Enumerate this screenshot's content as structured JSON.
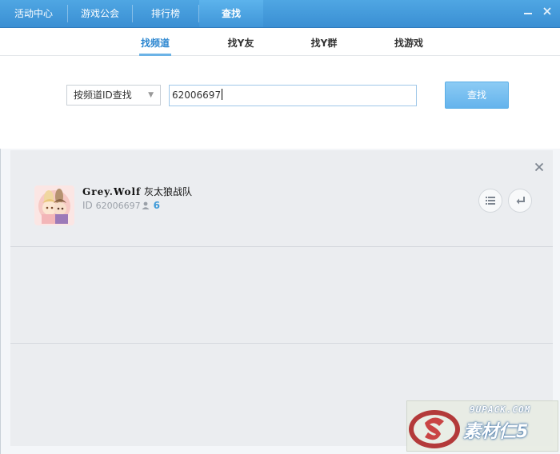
{
  "topnav": {
    "items": [
      {
        "label": "活动中心"
      },
      {
        "label": "游戏公会"
      },
      {
        "label": "排行榜"
      },
      {
        "label": "查找"
      }
    ],
    "active_index": 3,
    "minimize_icon": "minimize-icon",
    "close_icon": "close-icon"
  },
  "subtabs": {
    "items": [
      {
        "label": "找频道"
      },
      {
        "label": "找Y友"
      },
      {
        "label": "找Y群"
      },
      {
        "label": "找游戏"
      }
    ],
    "active_index": 0
  },
  "search": {
    "mode_selected": "按频道ID查找",
    "query_value": "62006697",
    "button_label": "查找"
  },
  "results": {
    "items": [
      {
        "name_en": "Grey.Wolf",
        "name_cn": "灰太狼战队",
        "id_label": "ID",
        "id_value": "62006697",
        "member_count": "6",
        "avatar_icon": "channel-avatar",
        "list_icon": "list-icon",
        "enter_icon": "enter-icon"
      }
    ]
  },
  "watermark": {
    "site": "9UPACK.COM",
    "brand": "素材仁5"
  },
  "colors": {
    "topbar": "#3a8fd3",
    "accent": "#2b86d0",
    "button": "#64b3ec",
    "member_count": "#3e9ad8"
  }
}
